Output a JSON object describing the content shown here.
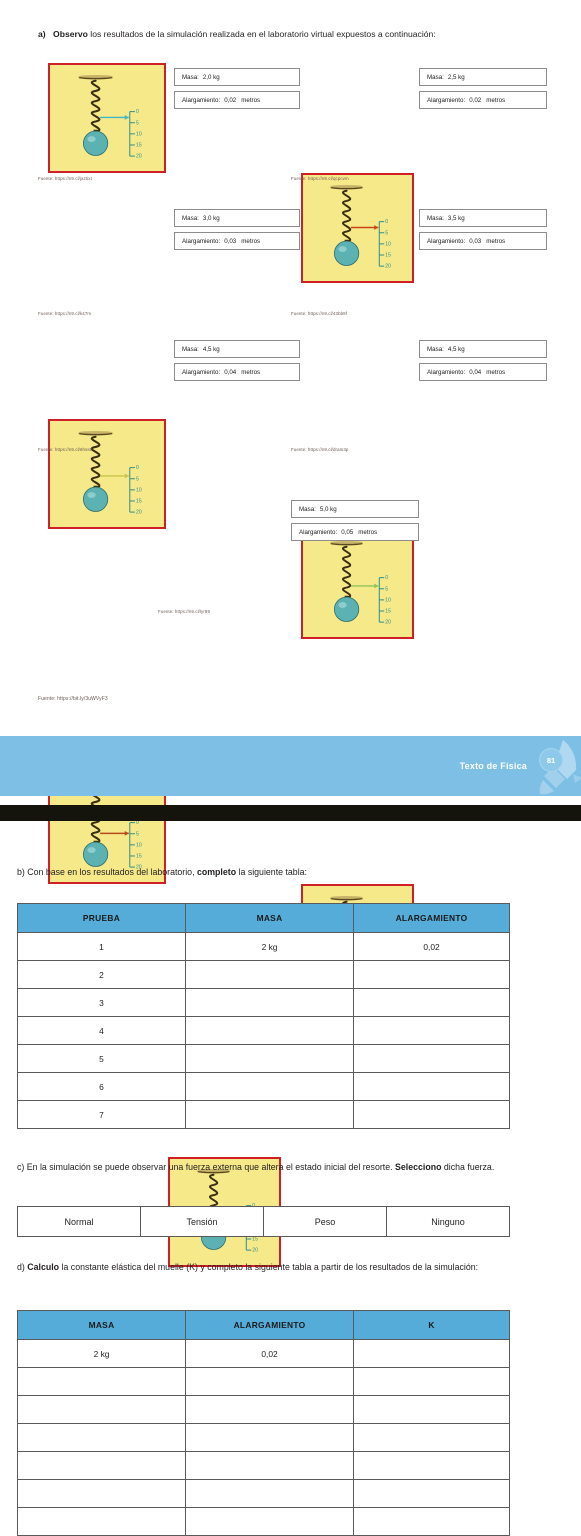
{
  "sections": {
    "a": {
      "marker": "a)",
      "bold": "Observo",
      "text": " los resultados de la simulación realizada en el laboratorio virtual expuestos a continuación:"
    },
    "b": {
      "marker": "b)",
      "pre": " Con base en los resultados del laboratorio, ",
      "bold": "completo",
      "post": " la siguiente tabla:"
    },
    "c": {
      "marker": "c)",
      "pre": " En la simulación se puede observar una fuerza externa que altera el estado inicial del resorte. ",
      "bold": "Selecciono",
      "post": " dicha fuerza."
    },
    "d": {
      "marker": "d)",
      "bold": "Calculo",
      "text": " la constante elástica del muelle (K) y completo la siguiente tabla a partir de los resultados de la simulación:"
    }
  },
  "simulations": [
    {
      "mass_label": "Masa:",
      "mass_value": "2,0 kg",
      "elong_label": "Alargamiento:",
      "elong_value": "0,02",
      "unit": "metros",
      "source": "Fuente: https://n9.cl/jaztixt",
      "arrow_color": "#3fb8c4",
      "marker_frac": 0.12
    },
    {
      "mass_label": "Masa:",
      "mass_value": "2,5 kg",
      "elong_label": "Alargamiento:",
      "elong_value": "0,02",
      "unit": "metros",
      "source": "Fuente: https://n9.cl/qcpcvm",
      "arrow_color": "#c8441c",
      "marker_frac": 0.12
    },
    {
      "mass_label": "Masa:",
      "mass_value": "3,0 kg",
      "elong_label": "Alargamiento:",
      "elong_value": "0,03",
      "unit": "metros",
      "source": "Fuente: https://n9.cl/k47m",
      "arrow_color": "#c8c44a",
      "marker_frac": 0.17
    },
    {
      "mass_label": "Masa:",
      "mass_value": "3,5 kg",
      "elong_label": "Alargamiento:",
      "elong_value": "0,03",
      "unit": "metros",
      "source": "Fuente: https://n9.cl/43bb9f",
      "arrow_color": "#8fc45a",
      "marker_frac": 0.17
    },
    {
      "mass_label": "Masa:",
      "mass_value": "4,5 kg",
      "elong_label": "Alargamiento:",
      "elong_value": "0,04",
      "unit": "metros",
      "source": "Fuente: https://n9.cl/6hss8",
      "arrow_color": "#b8481e",
      "marker_frac": 0.22
    },
    {
      "mass_label": "Masa:",
      "mass_value": "4,5 kg",
      "elong_label": "Alargamiento:",
      "elong_value": "0,04",
      "unit": "metros",
      "source": "Fuente: https://n9.cl/dram3p",
      "arrow_color": "#b8481e",
      "marker_frac": 0.22
    },
    {
      "mass_label": "Masa:",
      "mass_value": "5,0 kg",
      "elong_label": "Alargamiento:",
      "elong_value": "0,05",
      "unit": "metros",
      "source": "Fuente: https://n9.cl/lyr99",
      "arrow_color": "#d89a2a",
      "marker_frac": 0.27
    }
  ],
  "ruler_ticks": [
    "0",
    "5",
    "10",
    "15",
    "20"
  ],
  "global_source": "Fuente: https://bit.ly/3uWVyF3",
  "footer": {
    "title": "Texto de Física",
    "page_number": "81",
    "band_color": "#7ebfe6"
  },
  "table_b": {
    "headers": [
      "PRUEBA",
      "MASA",
      "ALARGAMIENTO"
    ],
    "rows": [
      [
        "1",
        "2 kg",
        "0,02"
      ],
      [
        "2",
        "",
        ""
      ],
      [
        "3",
        "",
        ""
      ],
      [
        "4",
        "",
        ""
      ],
      [
        "5",
        "",
        ""
      ],
      [
        "6",
        "",
        ""
      ],
      [
        "7",
        "",
        ""
      ]
    ]
  },
  "force_options": [
    "Normal",
    "Tensión",
    "Peso",
    "Ninguno"
  ],
  "table_d": {
    "headers": [
      "MASA",
      "ALARGAMIENTO",
      "K"
    ],
    "rows": [
      [
        "2 kg",
        "0,02",
        ""
      ],
      [
        "",
        "",
        ""
      ],
      [
        "",
        "",
        ""
      ],
      [
        "",
        "",
        ""
      ],
      [
        "",
        "",
        ""
      ],
      [
        "",
        "",
        ""
      ],
      [
        "",
        "",
        ""
      ]
    ]
  },
  "colors": {
    "header_blue": "#56acd9",
    "frame_red": "#cf2027",
    "panel_yellow": "#f7eb8e",
    "band_blue": "#7ebfe6"
  }
}
